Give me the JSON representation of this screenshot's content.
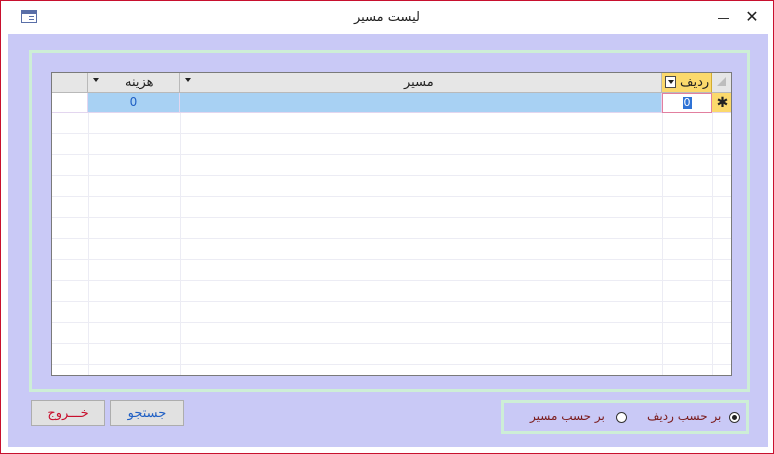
{
  "window": {
    "title": "لیست مسیر",
    "close_glyph": "✕",
    "app_icon": "form-icon"
  },
  "grid": {
    "columns": [
      {
        "key": "row",
        "label": "ردیف"
      },
      {
        "key": "route",
        "label": "مسیر"
      },
      {
        "key": "cost",
        "label": "هزینه"
      }
    ],
    "new_row": {
      "selector_glyph": "✱",
      "row_value": "0",
      "route_value": "",
      "cost_value": "0"
    }
  },
  "buttons": {
    "exit_label": "خـــروج",
    "search_label": "جستجو"
  },
  "sort_options": {
    "by_row_label": "بر حسب ردیف",
    "by_route_label": "بر حسب مسیر",
    "selected": "by_row"
  },
  "colors": {
    "header_selected": "#fbd96c",
    "row_highlight": "#a8d1f3",
    "form_background": "#c9c9f6",
    "frame_border": "#cdeed6"
  }
}
